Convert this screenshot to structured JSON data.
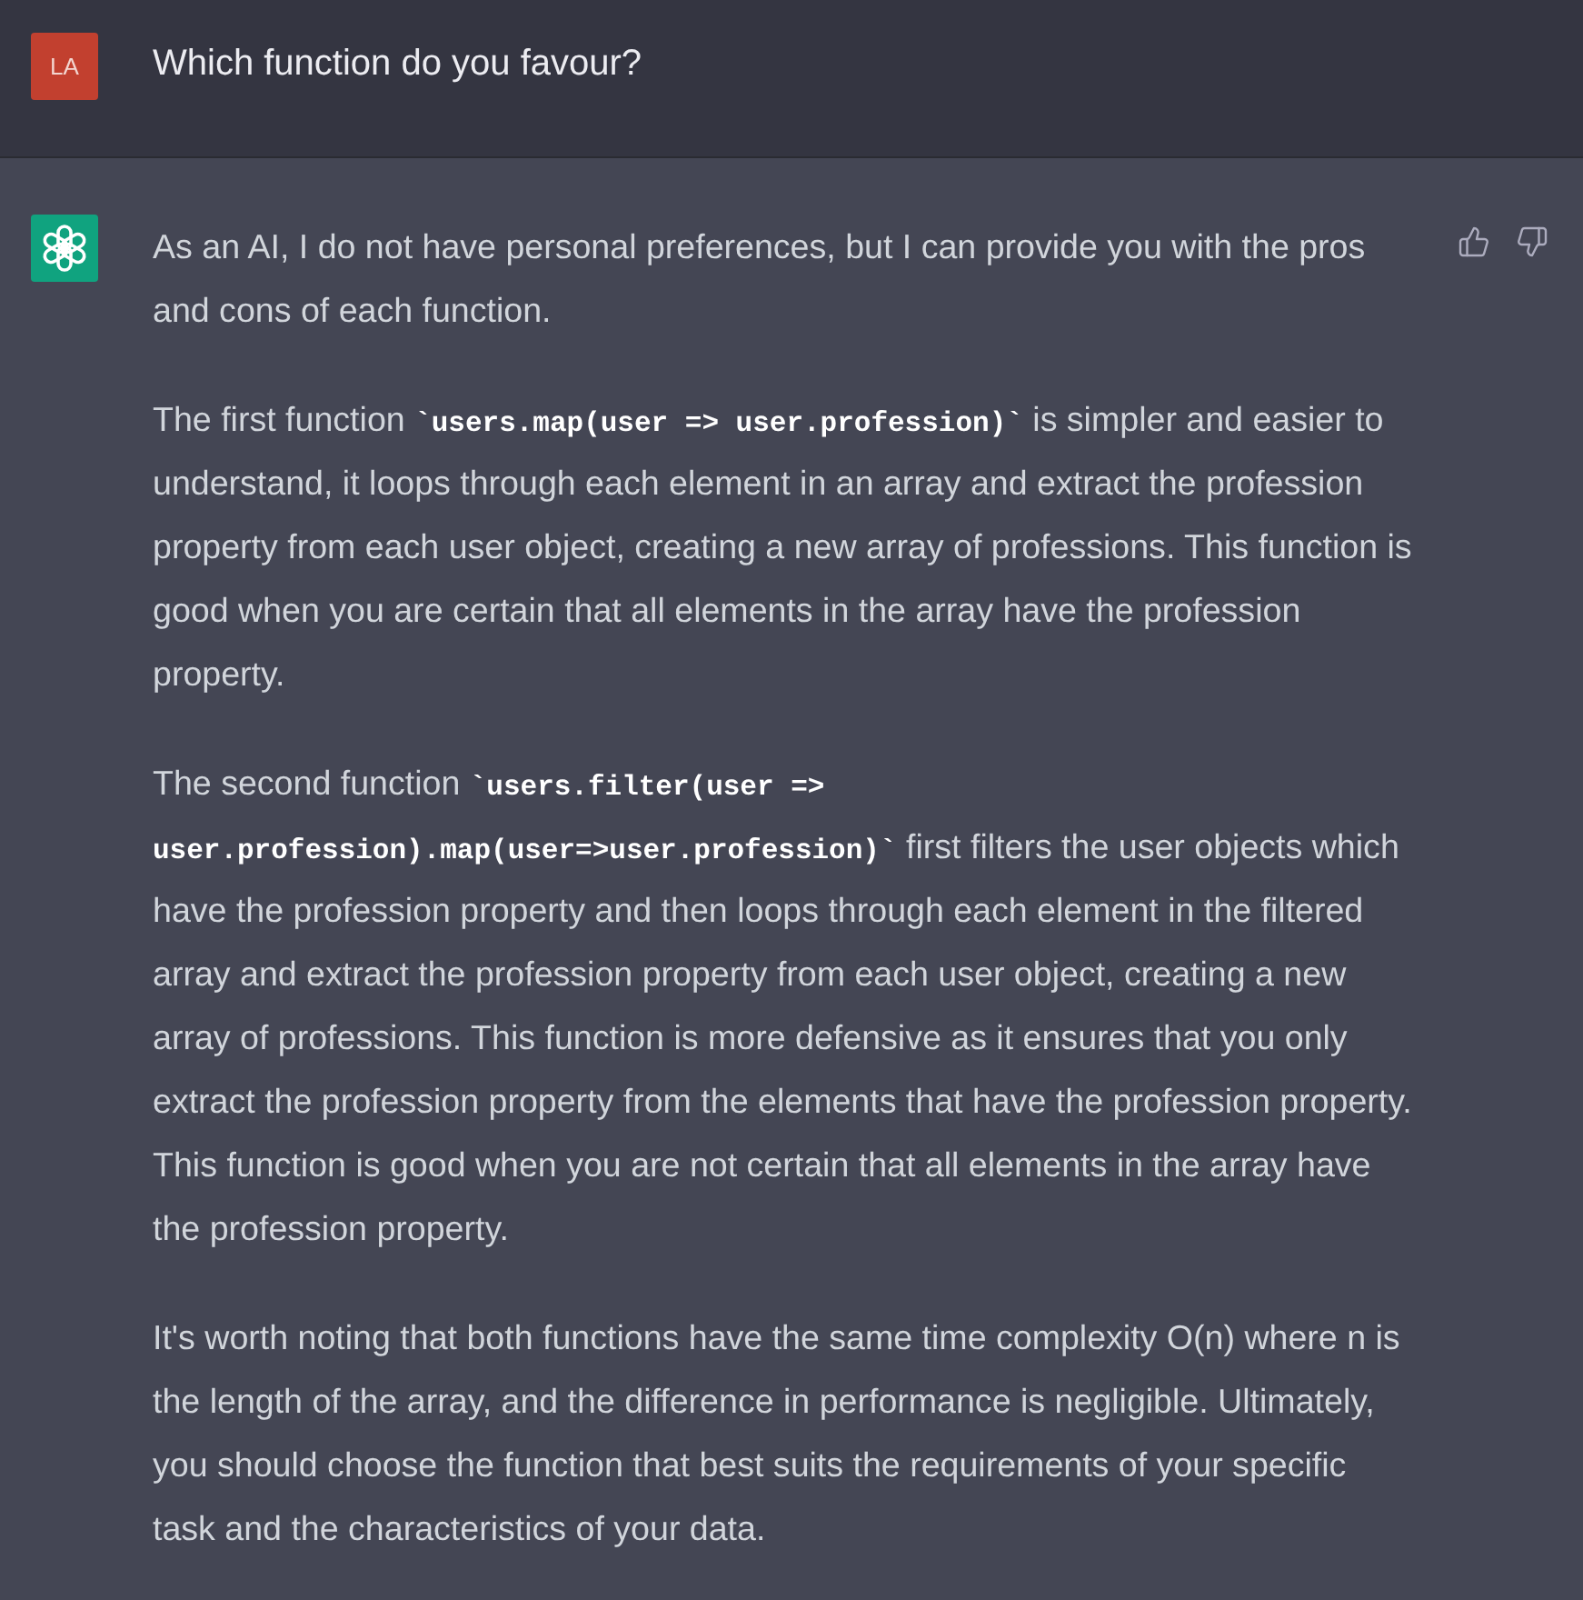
{
  "user_message": {
    "avatar_initials": "LA",
    "text": "Which function do you favour?"
  },
  "assistant_message": {
    "paragraphs": [
      [
        {
          "kind": "text",
          "text": "As an AI, I do not have personal preferences, but I can provide you with the pros and cons of each function."
        }
      ],
      [
        {
          "kind": "text",
          "text": "The first function "
        },
        {
          "kind": "code",
          "text": "`users.map(user => user.profession)`"
        },
        {
          "kind": "text",
          "text": " is simpler and easier to understand, it loops through each element in an array and extract the profession property from each user object, creating a new array of professions. This function is good when you are certain that all elements in the array have the profession property."
        }
      ],
      [
        {
          "kind": "text",
          "text": "The second function "
        },
        {
          "kind": "code",
          "text": "`users.filter(user => user.profession).map(user=>user.profession)`"
        },
        {
          "kind": "text",
          "text": " first filters the user objects which have the profession property and then loops through each element in the filtered array and extract the profession property from each user object, creating a new array of professions. This function is more defensive as it ensures that you only extract the profession property from the elements that have the profession property. This function is good when you are not certain that all elements in the array have the profession property."
        }
      ],
      [
        {
          "kind": "text",
          "text": "It's worth noting that both functions have the same time complexity O(n) where n is the length of the array, and the difference in performance is negligible. Ultimately, you should choose the function that best suits the requirements of your specific task and the characteristics of your data."
        }
      ]
    ]
  }
}
